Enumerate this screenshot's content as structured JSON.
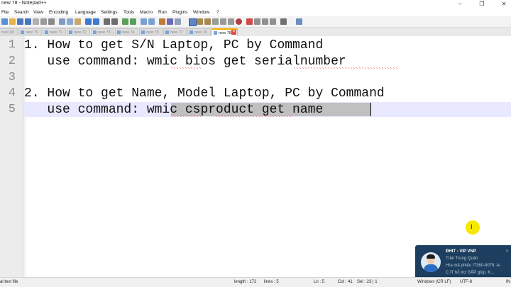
{
  "window": {
    "title": "new 78 - Notepad++"
  },
  "menu": [
    "File",
    "Search",
    "View",
    "Encoding",
    "Language",
    "Settings",
    "Tools",
    "Macro",
    "Run",
    "Plugins",
    "Window",
    "?"
  ],
  "tabs": [
    "new 69",
    "new 70",
    "new 71",
    "new 72",
    "new 73",
    "new 74",
    "new 75",
    "new 77",
    "new 76",
    "new 78"
  ],
  "active_tab": "new 78",
  "editor": {
    "line_numbers": [
      "1",
      "2",
      "3",
      "4",
      "5"
    ],
    "lines": [
      "1. How to get S/N Laptop, PC by Command",
      "   use command: wmic bios get serialnumber",
      "",
      "2. How to get Name, Model Laptop, PC by Command",
      "   use command: wmic csproduct get name"
    ]
  },
  "status": {
    "type": "al text file",
    "length": "length : 172",
    "lines": "lines : 5",
    "ln": "Ln : 5",
    "col": "Col : 41",
    "sel": "Sel : 23 | 1",
    "eol": "Windows (CR LF)",
    "encoding": "UTF-8",
    "mode": "IN"
  },
  "notification": {
    "title": "ĐHIT - VIP VNP",
    "line1": "Trần Trung Quân",
    "line2": "Hra mã phiếu IT360-8078: A/",
    "line3": "C IT hỗ trợ GẤP giúp. K..."
  },
  "colors": {
    "accent_tab": "#f2a900",
    "current_line": "#e8e8ff",
    "selection": "#c0c0c0",
    "popup_bg": "#1d3e5e",
    "cursor_highlight": "#f8e800"
  }
}
